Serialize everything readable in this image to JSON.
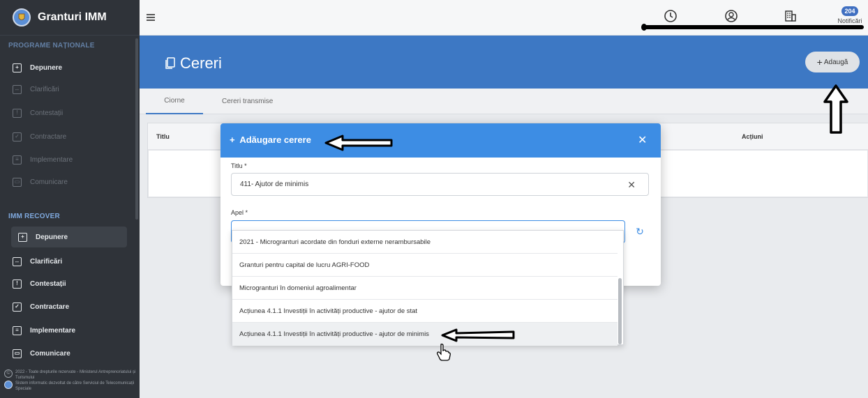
{
  "app": {
    "title": "Granturi IMM"
  },
  "sidebar": {
    "section1_title": "PROGRAME NAȚIONALE",
    "section1_items": [
      {
        "label": "Depunere",
        "icon": "upload-box-icon"
      },
      {
        "label": "Clarificări",
        "icon": "clarify-box-icon"
      },
      {
        "label": "Contestații",
        "icon": "exclamation-box-icon"
      },
      {
        "label": "Contractare",
        "icon": "check-box-icon"
      },
      {
        "label": "Implementare",
        "icon": "document-icon"
      },
      {
        "label": "Comunicare",
        "icon": "chat-icon"
      }
    ],
    "section2_title": "IMM RECOVER",
    "section2_items": [
      {
        "label": "Depunere",
        "icon": "upload-box-icon"
      },
      {
        "label": "Clarificări",
        "icon": "clarify-box-icon"
      },
      {
        "label": "Contestații",
        "icon": "exclamation-box-icon"
      },
      {
        "label": "Contractare",
        "icon": "check-box-icon"
      },
      {
        "label": "Implementare",
        "icon": "document-icon"
      },
      {
        "label": "Comunicare",
        "icon": "chat-icon"
      }
    ],
    "footer_line1": "2022 - Toate drepturile rezervate - Ministerul Antreprenoriatului și Turismului",
    "footer_line2": "Sistem informatic dezvoltat de către Serviciul de Telecomunicații Speciale"
  },
  "topbar": {
    "notifications_count": "204",
    "notifications_label": "Notificări"
  },
  "page": {
    "title": "Cereri",
    "add_button": "Adaugă",
    "tabs": [
      "Ciorne",
      "Cereri transmise"
    ],
    "table_headers": {
      "title": "Titlu",
      "actions": "Acțiuni"
    }
  },
  "modal": {
    "title": "Adăugare cerere",
    "field_title_label": "Titlu *",
    "field_title_value": "411- Ajutor de minimis",
    "field_apel_label": "Apel *",
    "field_apel_value": ""
  },
  "dropdown": {
    "options": [
      "2021 - Microgranturi acordate din fonduri externe nerambursabile",
      "Granturi pentru capital de lucru AGRI-FOOD",
      "Microgranturi în domeniul agroalimentar",
      "Acțiunea 4.1.1 Investiții în activități productive - ajutor de stat",
      "Acțiunea 4.1.1 Investiții în activități productive - ajutor de minimis"
    ]
  },
  "colors": {
    "sidebar_bg": "#2f3339",
    "header_blue": "#3d78c4",
    "modal_header": "#3d8de4",
    "badge": "#3f6fc1"
  }
}
